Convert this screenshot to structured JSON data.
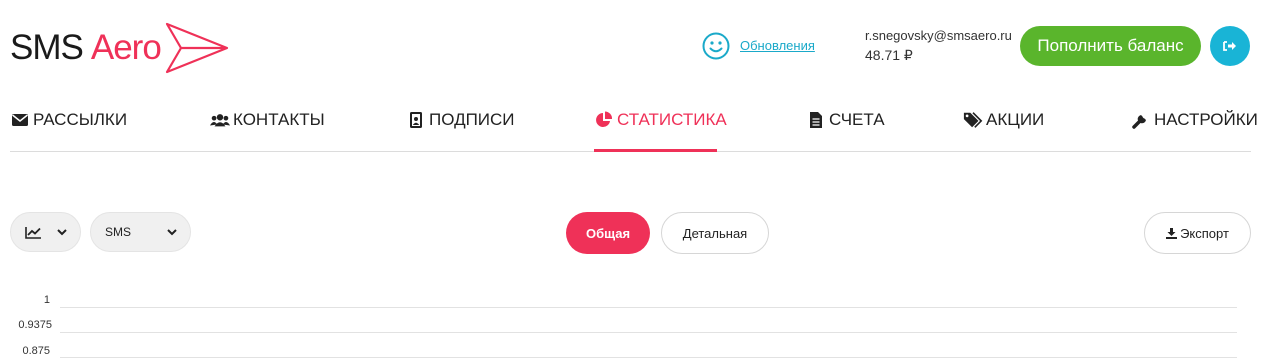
{
  "brand": {
    "part1": "SMS",
    "part2": "Aero",
    "accent": "#ef3158"
  },
  "header": {
    "updates_link": "Обновления",
    "email": "r.snegovsky@smsaero.ru",
    "balance": "48.71 ₽",
    "topup_label": "Пополнить баланс",
    "topup_color": "#5ab52c",
    "logout_color": "#19b4d6"
  },
  "nav": {
    "items": [
      {
        "label": "Рассылки",
        "icon": "envelope-icon"
      },
      {
        "label": "Контакты",
        "icon": "users-icon"
      },
      {
        "label": "Подписи",
        "icon": "badge-icon"
      },
      {
        "label": "Статистика",
        "icon": "pie-chart-icon",
        "active": true
      },
      {
        "label": "Счета",
        "icon": "document-icon"
      },
      {
        "label": "Акции",
        "icon": "tags-icon"
      },
      {
        "label": "Настройки",
        "icon": "wrench-icon"
      }
    ]
  },
  "toolbar": {
    "chart_select_icon": "line-chart-icon",
    "type_select_value": "SMS",
    "tab_general": "Общая",
    "tab_detail": "Детальная",
    "export_label": "Экспорт"
  },
  "chart_data": {
    "type": "line",
    "y_ticks": [
      "1",
      "0.9375",
      "0.875"
    ],
    "series": []
  }
}
